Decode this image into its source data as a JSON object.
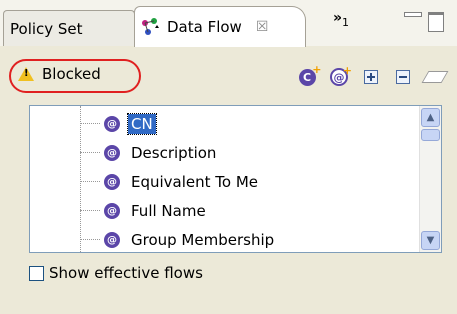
{
  "tabs": {
    "policy_set": "Policy Set",
    "data_flow": "Data Flow",
    "close_symbol": "☒",
    "overflow_label": "»",
    "overflow_count": "1"
  },
  "status": {
    "label": "Blocked",
    "icon": "warning-icon",
    "highlight_color": "#e02020"
  },
  "toolbar": {
    "buttons": [
      {
        "icon": "add-class-icon",
        "glyph": "C"
      },
      {
        "icon": "add-attribute-icon",
        "glyph": "@"
      },
      {
        "icon": "expand-all-icon"
      },
      {
        "icon": "collapse-all-icon"
      },
      {
        "icon": "clear-icon"
      }
    ]
  },
  "tree": {
    "items": [
      {
        "glyph": "@",
        "label": "CN",
        "selected": true
      },
      {
        "glyph": "@",
        "label": "Description",
        "selected": false
      },
      {
        "glyph": "@",
        "label": "Equivalent To Me",
        "selected": false
      },
      {
        "glyph": "@",
        "label": "Full Name",
        "selected": false
      },
      {
        "glyph": "@",
        "label": "Group Membership",
        "selected": false
      }
    ],
    "selection_color": "#316ac5"
  },
  "options": {
    "show_effective_flows": "Show effective flows",
    "show_effective_flows_checked": false
  }
}
